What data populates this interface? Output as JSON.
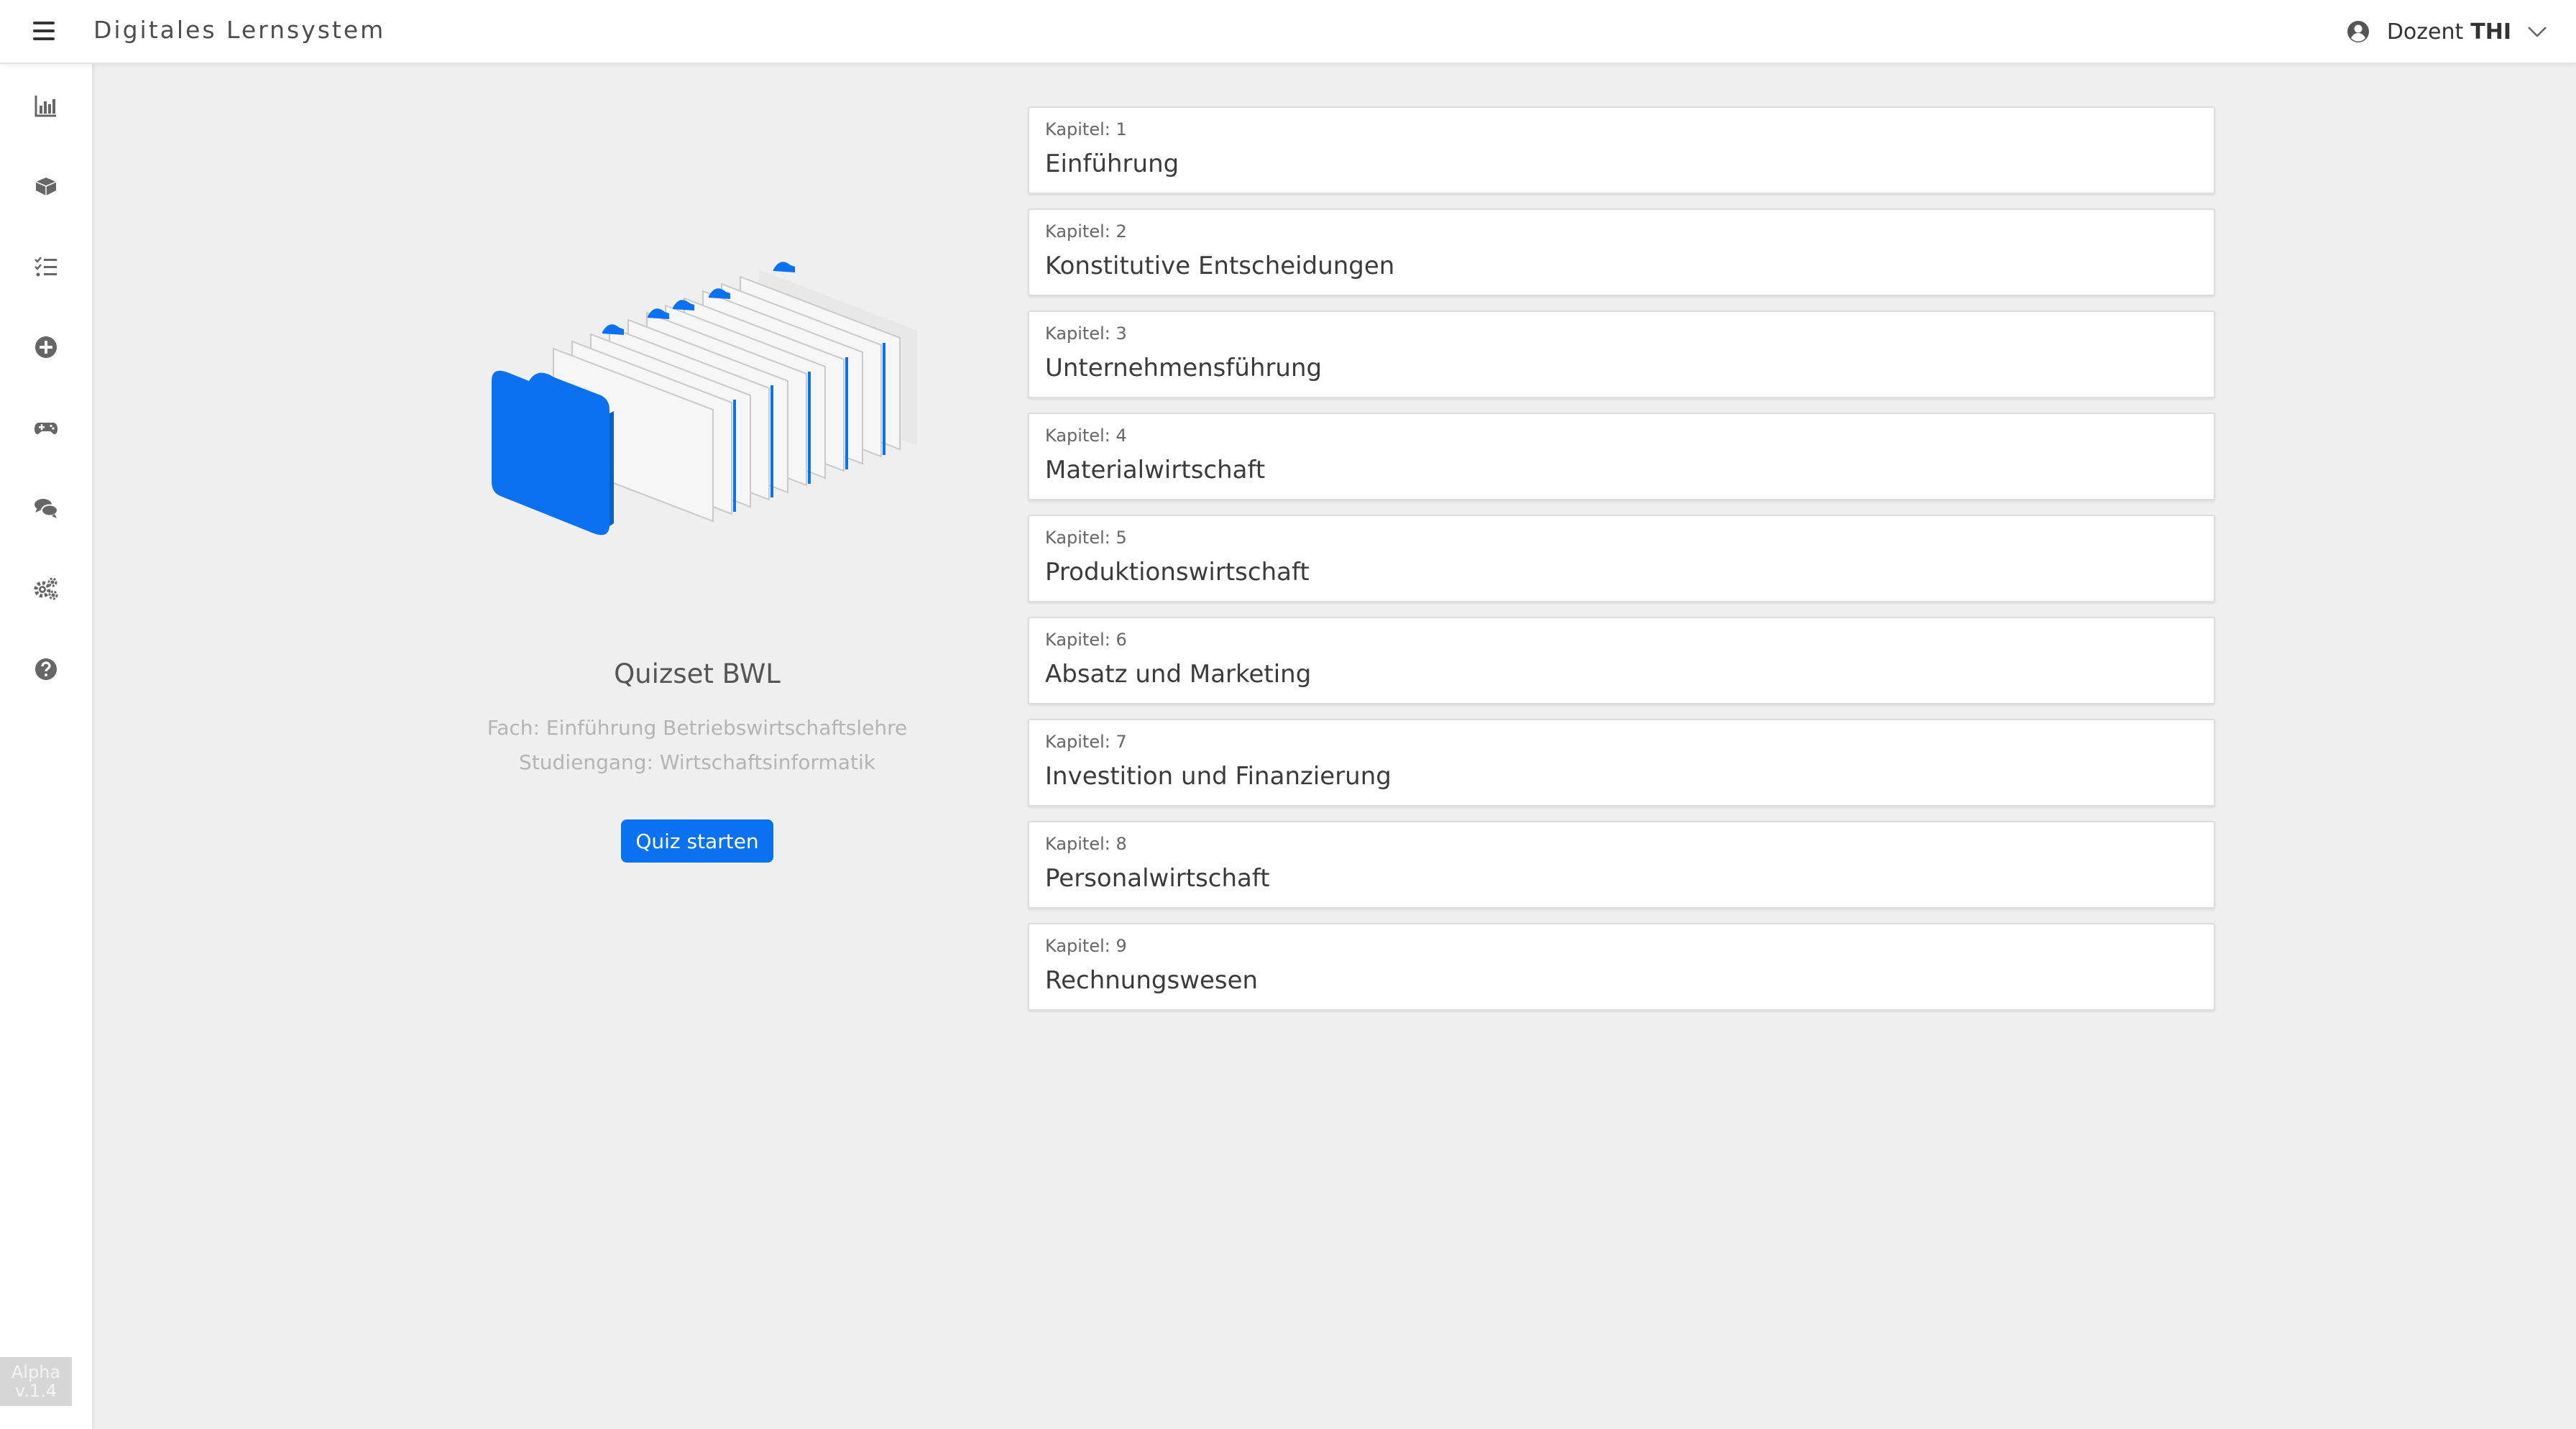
{
  "header": {
    "app_title": "Digitales Lernsystem",
    "user_prefix": "Dozent",
    "user_name": "THI"
  },
  "sidebar": {
    "items": [
      {
        "icon": "bar-chart-icon"
      },
      {
        "icon": "cards-icon"
      },
      {
        "icon": "checklist-icon"
      },
      {
        "icon": "add-circle-icon"
      },
      {
        "icon": "gamepad-icon"
      },
      {
        "icon": "chat-bubbles-icon"
      },
      {
        "icon": "gears-icon"
      },
      {
        "icon": "help-circle-icon"
      }
    ],
    "version_label": "Alpha",
    "version_number": "v.1.4"
  },
  "quiz": {
    "title": "Quizset BWL",
    "subject": "Fach: Einführung Betriebswirtschaftslehre",
    "program": "Studiengang: Wirtschaftsinformatik",
    "start_label": "Quiz starten"
  },
  "chapters": [
    {
      "kicker": "Kapitel: 1",
      "title": "Einführung"
    },
    {
      "kicker": "Kapitel: 2",
      "title": "Konstitutive Entscheidungen"
    },
    {
      "kicker": "Kapitel: 3",
      "title": "Unternehmensführung"
    },
    {
      "kicker": "Kapitel: 4",
      "title": "Materialwirtschaft"
    },
    {
      "kicker": "Kapitel: 5",
      "title": "Produktionswirtschaft"
    },
    {
      "kicker": "Kapitel: 6",
      "title": "Absatz und Marketing"
    },
    {
      "kicker": "Kapitel: 7",
      "title": "Investition und Finanzierung"
    },
    {
      "kicker": "Kapitel: 8",
      "title": "Personalwirtschaft"
    },
    {
      "kicker": "Kapitel: 9",
      "title": "Rechnungswesen"
    }
  ],
  "colors": {
    "accent": "#0a72f0",
    "background": "#efefef",
    "icon_gray": "#666666"
  }
}
